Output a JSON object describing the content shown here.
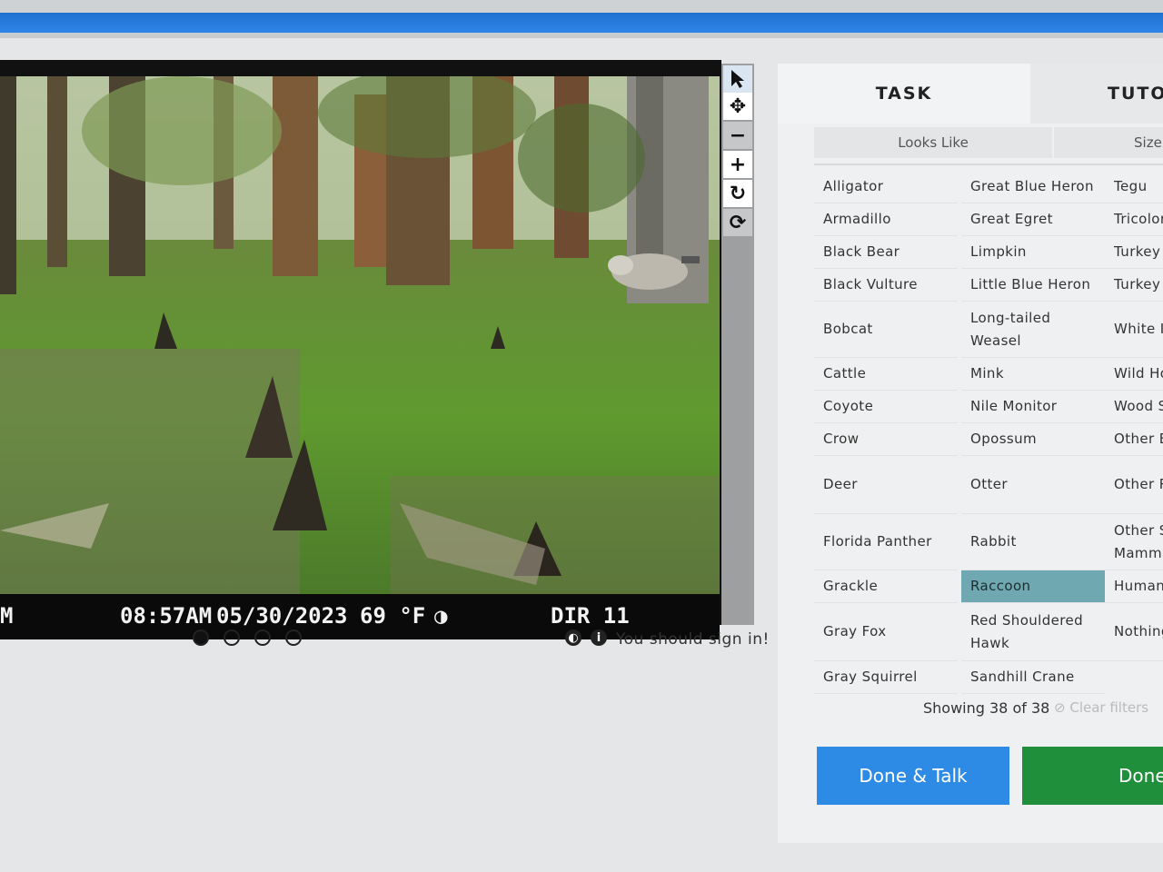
{
  "camera_overlay": {
    "brand": "M",
    "time": "08:57AM",
    "date": "05/30/2023",
    "temperature": "69 °F",
    "camera_id": "DIR 11"
  },
  "viewer": {
    "frames": [
      true,
      false,
      false,
      false
    ],
    "signin_text": "You should sign in!"
  },
  "task_panel": {
    "tabs": [
      "TASK",
      "TUTORIAL"
    ],
    "filters": [
      "Looks Like",
      "Size"
    ],
    "choices": [
      [
        "Alligator",
        "Great Blue Heron",
        "Tegu"
      ],
      [
        "Armadillo",
        "Great Egret",
        "Tricolored Heron"
      ],
      [
        "Black Bear",
        "Limpkin",
        "Turkey"
      ],
      [
        "Black Vulture",
        "Little Blue Heron",
        "Turkey Vulture"
      ],
      [
        "Bobcat",
        "Long-tailed Weasel",
        "White Ibis"
      ],
      [
        "Cattle",
        "Mink",
        "Wild Hog"
      ],
      [
        "Coyote",
        "Nile Monitor",
        "Wood Stork"
      ],
      [
        "Crow",
        "Opossum",
        "Other Bird"
      ],
      [
        "Deer",
        "Otter",
        "Other Reptile"
      ],
      [
        "Florida Panther",
        "Rabbit",
        "Other Small Mammal"
      ],
      [
        "Grackle",
        "Raccoon",
        "Human"
      ],
      [
        "Gray Fox",
        "Red Shouldered Hawk",
        "Nothing Here"
      ],
      [
        "Gray Squirrel",
        "Sandhill Crane",
        ""
      ]
    ],
    "selected_choice": "Raccoon",
    "showing_text": "Showing 38 of 38",
    "clear_filters": "Clear filters",
    "done_talk_label": "Done & Talk",
    "done_label": "Done"
  },
  "colors": {
    "header_blue": "#2e86e8",
    "done_talk": "#2d8be6",
    "done": "#1f8f3c",
    "selected": "#6fa8b0"
  }
}
